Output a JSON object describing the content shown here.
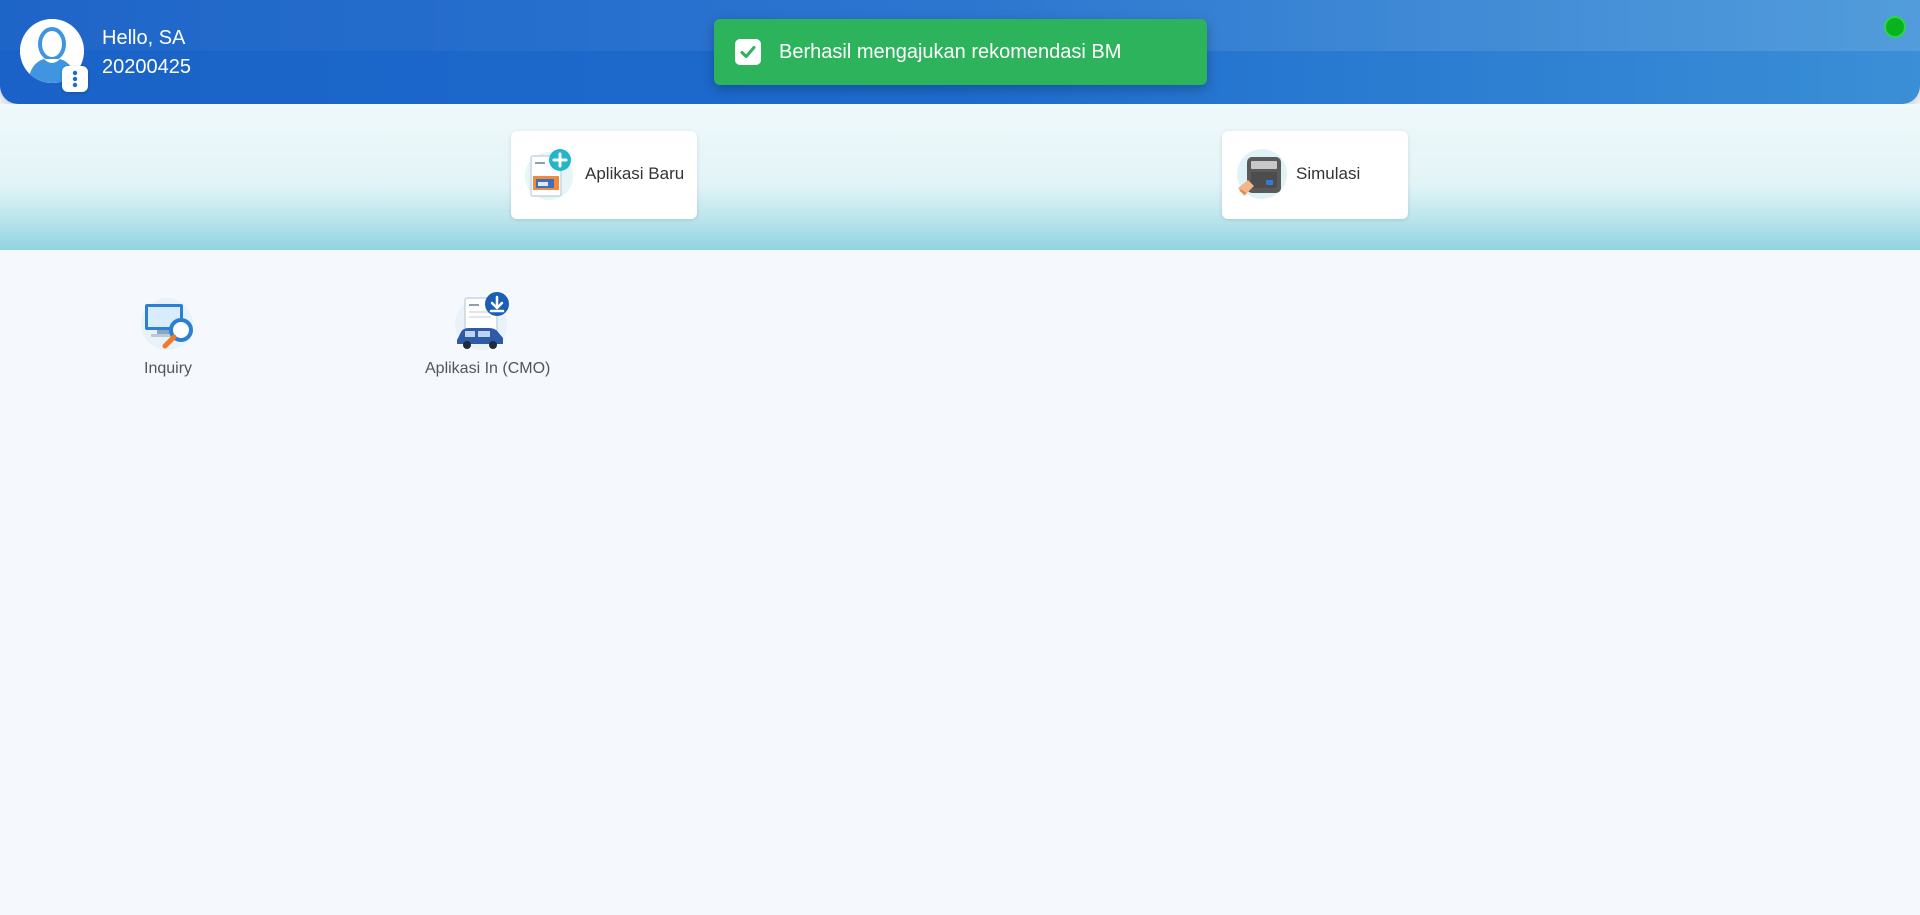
{
  "header": {
    "greeting": "Hello, SA",
    "user_id": "20200425",
    "status_color": "#08b41d",
    "avatar_icon": "user-avatar-icon",
    "menu_icon": "vertical-dots-icon"
  },
  "toast": {
    "message": "Berhasil mengajukan rekomendasi BM",
    "color": "#2db35c",
    "icon": "checkbox-check-icon"
  },
  "quick_actions": [
    {
      "label": "Aplikasi Baru",
      "icon": "new-application-icon"
    },
    {
      "label": "Simulasi",
      "icon": "calculator-icon"
    }
  ],
  "menu": [
    {
      "label": "Inquiry",
      "icon": "computer-search-icon"
    },
    {
      "label": "Aplikasi In (CMO)",
      "icon": "document-download-car-icon"
    }
  ]
}
